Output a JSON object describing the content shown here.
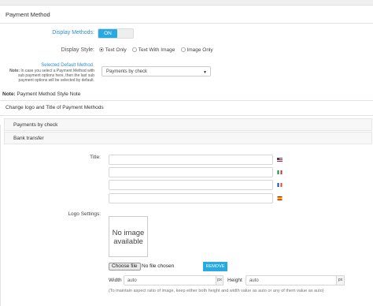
{
  "panel": {
    "title": "Payment Method"
  },
  "display_methods": {
    "label": "Display Methods:",
    "toggle_on": "ON"
  },
  "display_style": {
    "label": "Display Style:",
    "options": [
      "Text Only",
      "Text With Image",
      "Image Only"
    ],
    "selected": "Text Only"
  },
  "default_method": {
    "label": "Selected Default Method",
    "note_prefix": "Note:",
    "note_text": "In case you select a Payment Method with sub payment options here, then the last sub payment options will be selected by default.",
    "value": "Payments by check"
  },
  "style_note": {
    "prefix": "Note:",
    "text": "Payment Method Style Note"
  },
  "section": {
    "title": "Change logo and Title of Payment Methods"
  },
  "methods": [
    "Payments by check",
    "Bank transfer"
  ],
  "form": {
    "title_label": "Title:",
    "title_flags": [
      "us-flag-icon",
      "it-flag-icon",
      "fr-flag-icon",
      "es-flag-icon"
    ],
    "logo_label": "Logo Settings:",
    "no_image_line1": "No image",
    "no_image_line2": "available",
    "choose_file": "Choose file",
    "no_file": "No file chosen",
    "remove": "REMOVE",
    "width_label": "Width",
    "width_value": "auto",
    "height_label": "Height",
    "height_value": "auto",
    "px": "px",
    "hint": "(To maintain aspect ratio of image, keep either both height and width value as auto or any of them value as auto)"
  },
  "colors": {
    "accent": "#27a9e1",
    "label_blue": "#2e8fc6"
  }
}
